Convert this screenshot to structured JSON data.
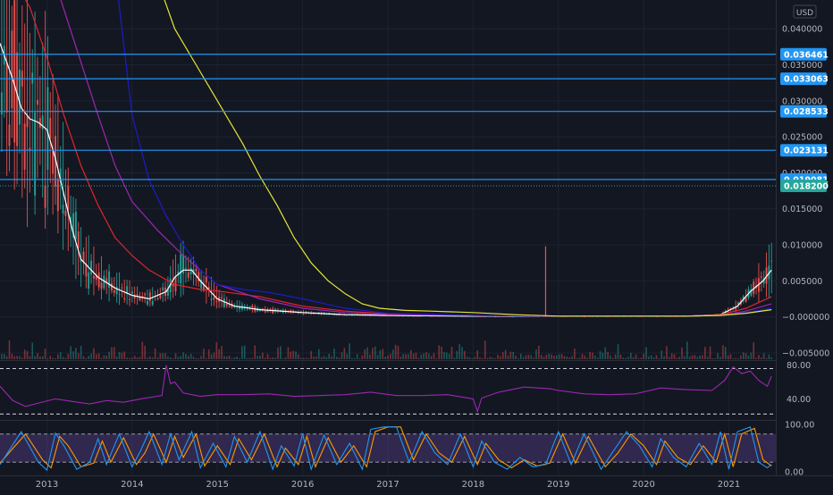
{
  "chart_data": {
    "type": "line",
    "symbol": "",
    "currency": "USD",
    "colors": {
      "background": "#131722",
      "grid": "#1e2230",
      "axis_text": "#b2b5be",
      "hline": "#2196f3",
      "last_price": "#26a69a",
      "ma_white": "#ffffff",
      "ma_red": "#e0262a",
      "ma_purple": "#9c27b0",
      "ma_blue": "#1c1cc8",
      "ma_yellow": "#e5e535",
      "candle_up": "#26a69a",
      "candle_down": "#ef5350",
      "rsi": "#9c27b0",
      "stoch_k": "#2196f3",
      "stoch_d": "#ff9800"
    },
    "main_pane": {
      "ylim": [
        -0.006,
        0.044
      ],
      "y_ticks": [
        {
          "v": 0.04,
          "label": "0.040000"
        },
        {
          "v": 0.035,
          "label": "0.035000"
        },
        {
          "v": 0.03,
          "label": "0.030000"
        },
        {
          "v": 0.025,
          "label": "0.025000"
        },
        {
          "v": 0.02,
          "label": "0.020000"
        },
        {
          "v": 0.015,
          "label": "0.015000"
        },
        {
          "v": 0.01,
          "label": "0.010000"
        },
        {
          "v": 0.005,
          "label": "0.005000"
        },
        {
          "v": 0.0,
          "label": "−0.000000"
        },
        {
          "v": -0.005,
          "label": "−0.005000"
        }
      ],
      "horizontal_levels": [
        {
          "v": 0.036461,
          "label": "0.036461"
        },
        {
          "v": 0.033063,
          "label": "0.033063"
        },
        {
          "v": 0.028533,
          "label": "0.028533"
        },
        {
          "v": 0.023131,
          "label": "0.023131"
        },
        {
          "v": 0.019081,
          "label": "0.019081"
        }
      ],
      "last_price": {
        "v": 0.0182,
        "label": "0.018200"
      }
    },
    "x_axis": {
      "xlim": [
        2012.45,
        2021.55
      ],
      "ticks": [
        {
          "v": 2013.0,
          "label": "2013"
        },
        {
          "v": 2014.0,
          "label": "2014"
        },
        {
          "v": 2015.0,
          "label": "2015"
        },
        {
          "v": 2016.0,
          "label": "2016"
        },
        {
          "v": 2017.0,
          "label": "2017"
        },
        {
          "v": 2018.0,
          "label": "2018"
        },
        {
          "v": 2019.0,
          "label": "2019"
        },
        {
          "v": 2020.0,
          "label": "2020"
        },
        {
          "v": 2021.0,
          "label": "2021"
        }
      ]
    },
    "series": [
      {
        "key": "ma_white",
        "x": [
          2012.45,
          2012.6,
          2012.7,
          2012.8,
          2012.9,
          2013.0,
          2013.1,
          2013.2,
          2013.3,
          2013.4,
          2013.6,
          2013.8,
          2014.0,
          2014.2,
          2014.4,
          2014.5,
          2014.6,
          2014.7,
          2014.8,
          2015.0,
          2015.2,
          2015.5,
          2016.0,
          2016.5,
          2017.0,
          2018.0,
          2019.0,
          2020.0,
          2020.5,
          2020.9,
          2021.1,
          2021.25,
          2021.4,
          2021.5
        ],
        "y": [
          0.038,
          0.033,
          0.029,
          0.0275,
          0.027,
          0.026,
          0.022,
          0.017,
          0.012,
          0.008,
          0.0055,
          0.004,
          0.003,
          0.0025,
          0.0035,
          0.0055,
          0.0065,
          0.0065,
          0.005,
          0.0025,
          0.0015,
          0.001,
          0.0006,
          0.0003,
          0.0002,
          0.0001,
          0.0001,
          0.0001,
          0.0001,
          0.0003,
          0.0015,
          0.0035,
          0.005,
          0.0065
        ]
      },
      {
        "key": "ma_red",
        "x": [
          2012.45,
          2012.8,
          2013.0,
          2013.2,
          2013.4,
          2013.6,
          2013.8,
          2014.0,
          2014.2,
          2014.5,
          2014.8,
          2015.0,
          2015.5,
          2016.0,
          2016.5,
          2017.0,
          2018.0,
          2019.0,
          2020.0,
          2020.5,
          2020.9,
          2021.2,
          2021.5
        ],
        "y": [
          0.05,
          0.043,
          0.036,
          0.028,
          0.021,
          0.0155,
          0.011,
          0.0085,
          0.0065,
          0.0045,
          0.0038,
          0.0036,
          0.0028,
          0.0015,
          0.0008,
          0.0004,
          0.0002,
          0.0001,
          0.0001,
          0.0001,
          0.0003,
          0.0012,
          0.0028
        ]
      },
      {
        "key": "ma_purple",
        "x": [
          2012.45,
          2012.8,
          2013.0,
          2013.3,
          2013.6,
          2013.8,
          2014.0,
          2014.3,
          2014.6,
          2015.0,
          2015.5,
          2016.0,
          2016.5,
          2017.0,
          2018.0,
          2019.0,
          2020.0,
          2020.5,
          2020.9,
          2021.2,
          2021.5
        ],
        "y": [
          0.07,
          0.058,
          0.05,
          0.039,
          0.028,
          0.021,
          0.016,
          0.012,
          0.0085,
          0.0045,
          0.0025,
          0.0012,
          0.0006,
          0.0003,
          0.0002,
          0.0001,
          0.0001,
          0.0001,
          0.0002,
          0.0008,
          0.0018
        ]
      },
      {
        "key": "ma_blue",
        "x": [
          2013.7,
          2013.8,
          2013.9,
          2014.0,
          2014.2,
          2014.4,
          2014.6,
          2014.8,
          2015.0,
          2015.3,
          2015.6,
          2016.0,
          2016.5,
          2017.0,
          2018.0,
          2019.0,
          2020.0,
          2020.5,
          2020.9,
          2021.2,
          2021.5
        ],
        "y": [
          0.06,
          0.048,
          0.038,
          0.028,
          0.019,
          0.014,
          0.01,
          0.0065,
          0.0045,
          0.0038,
          0.0034,
          0.0025,
          0.0012,
          0.0005,
          0.0002,
          0.0001,
          0.0001,
          0.0001,
          0.0002,
          0.0006,
          0.0012
        ]
      },
      {
        "key": "ma_yellow",
        "x": [
          2014.35,
          2014.5,
          2014.7,
          2014.9,
          2015.1,
          2015.3,
          2015.5,
          2015.7,
          2015.9,
          2016.1,
          2016.3,
          2016.5,
          2016.7,
          2016.9,
          2017.2,
          2017.5,
          2018.0,
          2018.5,
          2019.0,
          2019.5,
          2020.0,
          2020.5,
          2020.9,
          2021.2,
          2021.5
        ],
        "y": [
          0.045,
          0.04,
          0.036,
          0.032,
          0.028,
          0.024,
          0.0195,
          0.0155,
          0.011,
          0.0075,
          0.005,
          0.0032,
          0.0018,
          0.0012,
          0.0009,
          0.0008,
          0.0006,
          0.0003,
          0.0001,
          0.0001,
          0.0001,
          0.0001,
          0.0002,
          0.0005,
          0.001
        ]
      }
    ],
    "spike": {
      "x": 2018.85,
      "y": 0.0098
    },
    "rsi_pane": {
      "ylim": [
        15,
        85
      ],
      "ticks": [
        {
          "v": 80,
          "label": "80.00"
        },
        {
          "v": 40,
          "label": "40.00"
        }
      ],
      "bands": [
        76,
        22
      ],
      "x": [
        2012.45,
        2012.6,
        2012.75,
        2012.9,
        2013.1,
        2013.3,
        2013.5,
        2013.7,
        2013.9,
        2014.1,
        2014.35,
        2014.4,
        2014.45,
        2014.5,
        2014.6,
        2014.8,
        2015.0,
        2015.3,
        2015.6,
        2015.9,
        2016.2,
        2016.5,
        2016.8,
        2017.1,
        2017.4,
        2017.7,
        2018.0,
        2018.05,
        2018.1,
        2018.3,
        2018.6,
        2018.9,
        2019.0,
        2019.3,
        2019.6,
        2019.9,
        2020.2,
        2020.5,
        2020.8,
        2020.95,
        2021.05,
        2021.15,
        2021.25,
        2021.35,
        2021.45,
        2021.5
      ],
      "y": [
        55,
        38,
        31,
        35,
        40,
        37,
        34,
        38,
        36,
        40,
        44,
        80,
        58,
        60,
        47,
        43,
        45,
        45,
        46,
        43,
        44,
        45,
        48,
        44,
        44,
        45,
        40,
        25,
        41,
        48,
        54,
        52,
        50,
        46,
        45,
        46,
        53,
        51,
        50,
        62,
        78,
        70,
        73,
        62,
        55,
        67
      ]
    },
    "stoch_pane": {
      "ylim": [
        -8,
        108
      ],
      "ticks": [
        {
          "v": 100,
          "label": "100.00"
        },
        {
          "v": 0,
          "label": "0.00"
        }
      ],
      "bands": [
        80,
        20
      ],
      "k_x": [
        2012.45,
        2012.7,
        2012.9,
        2013.0,
        2013.1,
        2013.2,
        2013.35,
        2013.5,
        2013.6,
        2013.7,
        2013.85,
        2014.0,
        2014.1,
        2014.2,
        2014.35,
        2014.45,
        2014.55,
        2014.7,
        2014.8,
        2014.95,
        2015.1,
        2015.2,
        2015.35,
        2015.5,
        2015.65,
        2015.75,
        2015.9,
        2016.0,
        2016.1,
        2016.25,
        2016.4,
        2016.55,
        2016.7,
        2016.8,
        2016.95,
        2017.1,
        2017.25,
        2017.4,
        2017.55,
        2017.7,
        2017.85,
        2018.0,
        2018.1,
        2018.25,
        2018.4,
        2018.55,
        2018.7,
        2018.85,
        2019.0,
        2019.15,
        2019.3,
        2019.5,
        2019.65,
        2019.8,
        2019.95,
        2020.1,
        2020.2,
        2020.35,
        2020.5,
        2020.65,
        2020.8,
        2020.9,
        2021.0,
        2021.1,
        2021.25,
        2021.35,
        2021.45,
        2021.5
      ],
      "k_y": [
        15,
        85,
        20,
        3,
        82,
        55,
        5,
        20,
        70,
        15,
        80,
        10,
        45,
        85,
        15,
        80,
        25,
        85,
        8,
        60,
        10,
        75,
        20,
        85,
        5,
        55,
        12,
        80,
        5,
        78,
        15,
        60,
        5,
        90,
        95,
        95,
        20,
        85,
        40,
        15,
        80,
        10,
        65,
        20,
        5,
        30,
        10,
        15,
        85,
        15,
        80,
        5,
        45,
        85,
        55,
        10,
        70,
        30,
        10,
        60,
        15,
        85,
        5,
        85,
        95,
        20,
        8,
        15
      ],
      "d_x": [
        2012.45,
        2012.75,
        2012.95,
        2013.05,
        2013.15,
        2013.25,
        2013.4,
        2013.55,
        2013.65,
        2013.75,
        2013.9,
        2014.05,
        2014.15,
        2014.25,
        2014.4,
        2014.5,
        2014.6,
        2014.75,
        2014.85,
        2015.0,
        2015.15,
        2015.25,
        2015.4,
        2015.55,
        2015.7,
        2015.8,
        2015.95,
        2016.05,
        2016.15,
        2016.3,
        2016.45,
        2016.6,
        2016.75,
        2016.85,
        2017.0,
        2017.15,
        2017.3,
        2017.45,
        2017.6,
        2017.75,
        2017.9,
        2018.05,
        2018.15,
        2018.3,
        2018.45,
        2018.6,
        2018.75,
        2018.9,
        2019.05,
        2019.2,
        2019.35,
        2019.55,
        2019.7,
        2019.85,
        2020.0,
        2020.15,
        2020.25,
        2020.4,
        2020.55,
        2020.7,
        2020.85,
        2020.95,
        2021.05,
        2021.15,
        2021.3,
        2021.4,
        2021.5
      ],
      "d_y": [
        18,
        80,
        25,
        8,
        75,
        55,
        10,
        18,
        65,
        20,
        72,
        15,
        40,
        80,
        20,
        75,
        30,
        80,
        12,
        55,
        15,
        70,
        25,
        80,
        10,
        50,
        15,
        75,
        10,
        72,
        20,
        55,
        10,
        85,
        95,
        95,
        25,
        80,
        40,
        20,
        75,
        15,
        60,
        25,
        8,
        25,
        12,
        18,
        80,
        18,
        75,
        10,
        40,
        80,
        55,
        15,
        65,
        30,
        15,
        55,
        20,
        80,
        10,
        80,
        92,
        25,
        12
      ]
    }
  }
}
